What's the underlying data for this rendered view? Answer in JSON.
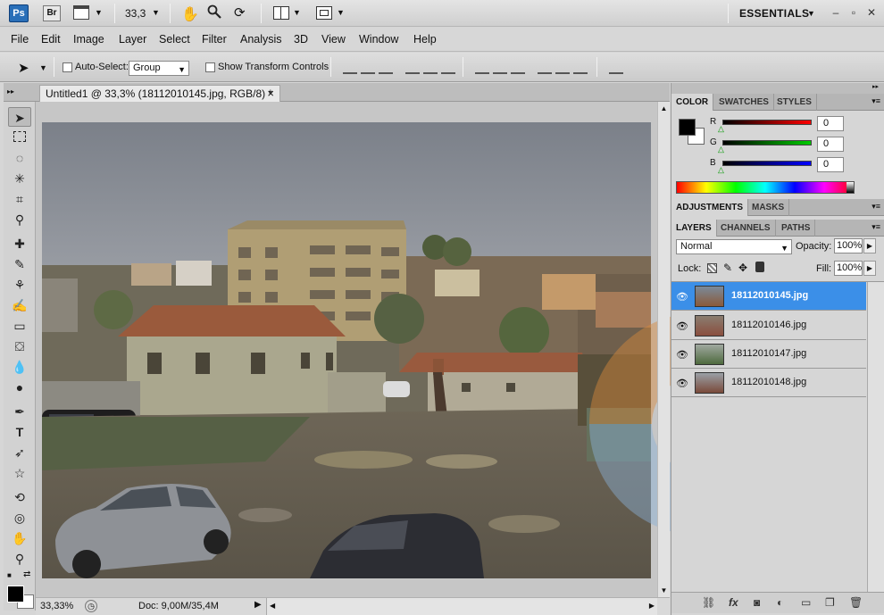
{
  "appbar": {
    "app_icon": "Ps",
    "bridge_icon": "Br",
    "zoom": "33,3",
    "workspace": "ESSENTIALS",
    "icons": [
      "hand-icon",
      "zoom-icon",
      "rotate-view-icon",
      "arrange-documents-icon",
      "screen-mode-icon"
    ]
  },
  "menu": [
    "File",
    "Edit",
    "Image",
    "Layer",
    "Select",
    "Filter",
    "Analysis",
    "3D",
    "View",
    "Window",
    "Help"
  ],
  "options": {
    "auto_select_label": "Auto-Select:",
    "auto_select_value": "Group",
    "transform_label": "Show Transform Controls"
  },
  "document": {
    "tab_title": "Untitled1 @ 33,3% (18112010145.jpg, RGB/8) *",
    "close": "×"
  },
  "status": {
    "zoom": "33,33%",
    "doc": "Doc: 9,00M/35,4M"
  },
  "color_panel": {
    "tabs": [
      "COLOR",
      "SWATCHES",
      "STYLES"
    ],
    "r_label": "R",
    "g_label": "G",
    "b_label": "B",
    "r": "0",
    "g": "0",
    "b": "0"
  },
  "adjustments_panel": {
    "tabs": [
      "ADJUSTMENTS",
      "MASKS"
    ]
  },
  "layers_panel": {
    "tabs": [
      "LAYERS",
      "CHANNELS",
      "PATHS"
    ],
    "blend_mode": "Normal",
    "opacity_label": "Opacity:",
    "opacity": "100%",
    "lock_label": "Lock:",
    "fill_label": "Fill:",
    "fill": "100%",
    "layers": [
      {
        "name": "18112010145.jpg",
        "selected": true
      },
      {
        "name": "18112010146.jpg",
        "selected": false
      },
      {
        "name": "18112010147.jpg",
        "selected": false
      },
      {
        "name": "18112010148.jpg",
        "selected": false
      }
    ]
  },
  "colors": {
    "selected_layer": "#3b8fe8",
    "ps_blue": "#2a6fb8"
  }
}
